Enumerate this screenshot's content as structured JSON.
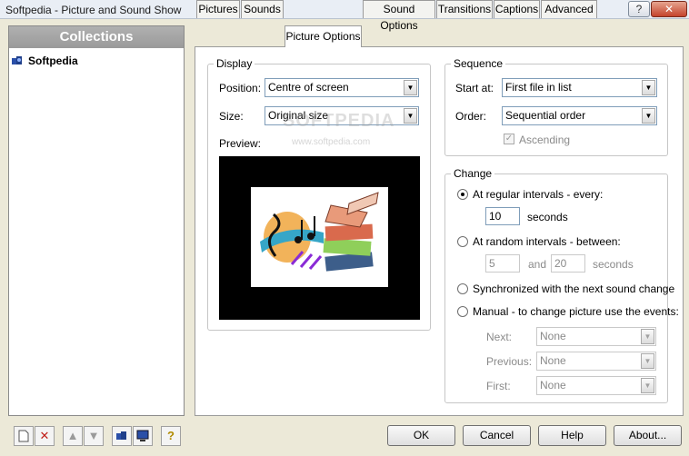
{
  "window": {
    "title": "Softpedia - Picture and Sound Show",
    "help_btn": "?",
    "close_btn": "✕"
  },
  "collections": {
    "header": "Collections",
    "items": [
      {
        "label": "Softpedia"
      }
    ]
  },
  "tabs": [
    {
      "label": "Pictures"
    },
    {
      "label": "Sounds"
    },
    {
      "label": "Picture Options",
      "selected": true
    },
    {
      "label": "Sound Options"
    },
    {
      "label": "Transitions"
    },
    {
      "label": "Captions"
    },
    {
      "label": "Advanced"
    }
  ],
  "display": {
    "title": "Display",
    "position_label": "Position:",
    "position_value": "Centre of screen",
    "size_label": "Size:",
    "size_value": "Original size",
    "preview_label": "Preview:"
  },
  "sequence": {
    "title": "Sequence",
    "start_label": "Start at:",
    "start_value": "First file in list",
    "order_label": "Order:",
    "order_value": "Sequential order",
    "ascending_label": "Ascending",
    "ascending_checked": true
  },
  "change": {
    "title": "Change",
    "regular_label": "At regular intervals - every:",
    "regular_value": "10",
    "seconds": "seconds",
    "random_label": "At random intervals - between:",
    "random_min": "5",
    "and": "and",
    "random_max": "20",
    "sync_label": "Synchronized with the next sound change",
    "manual_label": "Manual - to change picture use the events:",
    "next_label": "Next:",
    "next_value": "None",
    "previous_label": "Previous:",
    "previous_value": "None",
    "first_label": "First:",
    "first_value": "None",
    "selected": "regular"
  },
  "buttons": {
    "ok": "OK",
    "cancel": "Cancel",
    "help": "Help",
    "about": "About..."
  },
  "watermark": {
    "text": "SOFTPEDIA",
    "sub": "www.softpedia.com"
  },
  "colors": {
    "accent": "#316ac5",
    "header_gray": "#a3a3a3",
    "window_bg": "#ece9d8"
  }
}
